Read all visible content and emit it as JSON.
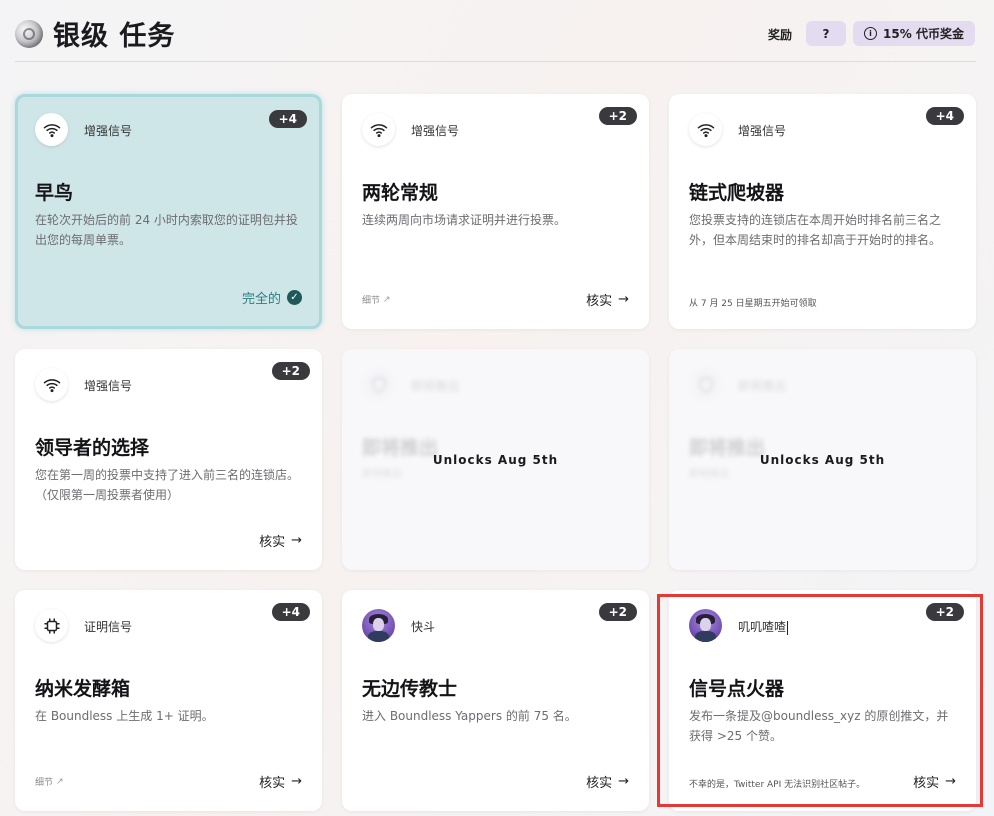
{
  "header": {
    "title": "银级 任务",
    "reward_label": "奖励",
    "help_label": "?",
    "bonus_label": "15% 代币奖金"
  },
  "cards": [
    {
      "badge": "+4",
      "type_label": "增强信号",
      "type_icon": "wifi-icon",
      "title": "早鸟",
      "desc": "在轮次开始后的前 24 小时内索取您的证明包并投出您的每周单票。",
      "status": "完全的"
    },
    {
      "badge": "+2",
      "type_label": "增强信号",
      "type_icon": "wifi-icon",
      "title": "两轮常规",
      "desc": "连续两周向市场请求证明并进行投票。",
      "details": "细节",
      "verify": "核实"
    },
    {
      "badge": "+4",
      "type_label": "增强信号",
      "type_icon": "wifi-icon",
      "title": "链式爬坡器",
      "desc": "您投票支持的连锁店在本周开始时排名前三名之外，但本周结束时的排名却高于开始时的排名。",
      "claim_note": "从 7 月 25 日星期五开始可领取"
    },
    {
      "badge": "+2",
      "type_label": "增强信号",
      "type_icon": "wifi-icon",
      "title": "领导者的选择",
      "desc": "您在第一周的投票中支持了进入前三名的连锁店。（仅限第一周投票者使用）",
      "verify": "核实"
    },
    {
      "type_label": "即将推出",
      "type_icon": "shield-icon",
      "title": "即将推出",
      "desc": "即将推出",
      "unlock": "Unlocks Aug 5th"
    },
    {
      "type_label": "即将推出",
      "type_icon": "shield-icon",
      "title": "即将推出",
      "desc": "即将推出",
      "unlock": "Unlocks Aug 5th"
    },
    {
      "badge": "+4",
      "type_label": "证明信号",
      "type_icon": "chip-icon",
      "title": "纳米发酵箱",
      "desc": "在 Boundless 上生成 1+ 证明。",
      "details": "细节",
      "verify": "核实"
    },
    {
      "badge": "+2",
      "type_label": "快斗",
      "type_icon": "avatar",
      "title": "无边传教士",
      "desc": "进入 Boundless Yappers 的前 75 名。",
      "verify": "核实"
    },
    {
      "badge": "+2",
      "type_label": "叽叽喳喳",
      "type_icon": "avatar",
      "title": "信号点火器",
      "desc": "发布一条提及@boundless_xyz 的原创推文，并获得 >25 个赞。",
      "claim_note": "不幸的是，Twitter API 无法识别社区帖子。",
      "verify": "核实"
    }
  ],
  "colors": {
    "accent": "#e3dbf0",
    "completed_bg": "#cfe6e8",
    "highlight": "#e53935"
  }
}
